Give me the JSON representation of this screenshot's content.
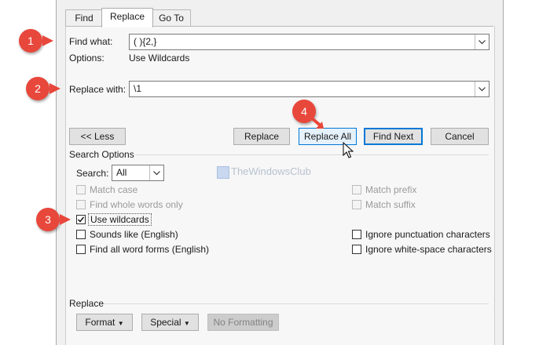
{
  "tabs": [
    {
      "label": "Find",
      "active": false
    },
    {
      "label": "Replace",
      "active": true
    },
    {
      "label": "Go To",
      "active": false
    }
  ],
  "find": {
    "label": "Find what:",
    "value": "( ){2,}",
    "options_label": "Options:",
    "options_value": "Use Wildcards"
  },
  "replace": {
    "label": "Replace with:",
    "value": "\\1"
  },
  "buttons": {
    "less": "<< Less",
    "replace": "Replace",
    "replace_all": "Replace All",
    "find_next": "Find Next",
    "cancel": "Cancel"
  },
  "search_options": {
    "title": "Search Options",
    "search_label": "Search:",
    "search_value": "All",
    "checkboxes": [
      {
        "label": "Match case",
        "checked": false,
        "enabled": false
      },
      {
        "label": "Find whole words only",
        "checked": false,
        "enabled": false
      },
      {
        "label": "Use wildcards",
        "checked": true,
        "enabled": true
      },
      {
        "label": "Sounds like (English)",
        "checked": false,
        "enabled": true
      },
      {
        "label": "Find all word forms (English)",
        "checked": false,
        "enabled": true
      },
      {
        "label": "Match prefix",
        "checked": false,
        "enabled": false
      },
      {
        "label": "Match suffix",
        "checked": false,
        "enabled": false
      },
      {
        "label": "Ignore punctuation characters",
        "checked": false,
        "enabled": true
      },
      {
        "label": "Ignore white-space characters",
        "checked": false,
        "enabled": true
      }
    ]
  },
  "replace_section": {
    "title": "Replace",
    "format": "Format",
    "special": "Special",
    "no_formatting": "No Formatting"
  },
  "watermark": "TheWindowsClub",
  "callouts": [
    "1",
    "2",
    "3",
    "4"
  ],
  "colors": {
    "callout": "#e8473b",
    "accent": "#0078d7",
    "title_bar": "#2b6cb8"
  }
}
